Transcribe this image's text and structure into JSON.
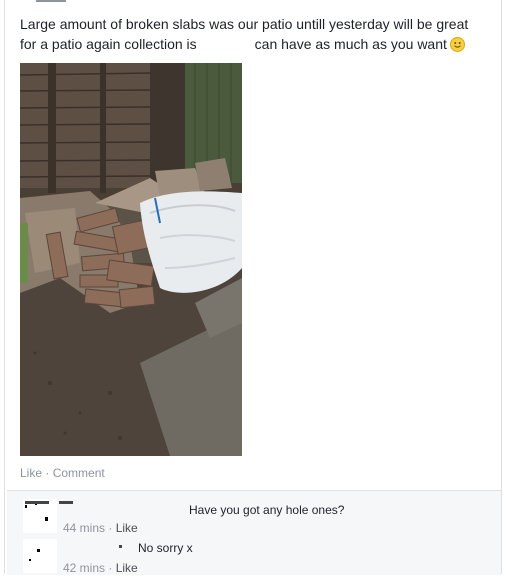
{
  "post": {
    "text_line1": "Large amount of broken slabs was our patio untill yesterday will be great",
    "text_line2_a": "for a patio again collection is",
    "text_line2_b": "can have as much as you want",
    "emoji": "smile-emoji"
  },
  "actions": {
    "like": "Like",
    "separator": " · ",
    "comment": "Comment"
  },
  "comments": [
    {
      "text": "Have you got any hole ones?",
      "time": "44 mins",
      "sep": " · ",
      "like": "Like"
    },
    {
      "text": "No sorry x",
      "time": "42 mins",
      "sep": " · ",
      "like": "Like"
    }
  ],
  "colors": {
    "link": "#8d949e",
    "meta": "#90949c",
    "text": "#1d2129",
    "comment_bg": "#f6f7f9"
  }
}
